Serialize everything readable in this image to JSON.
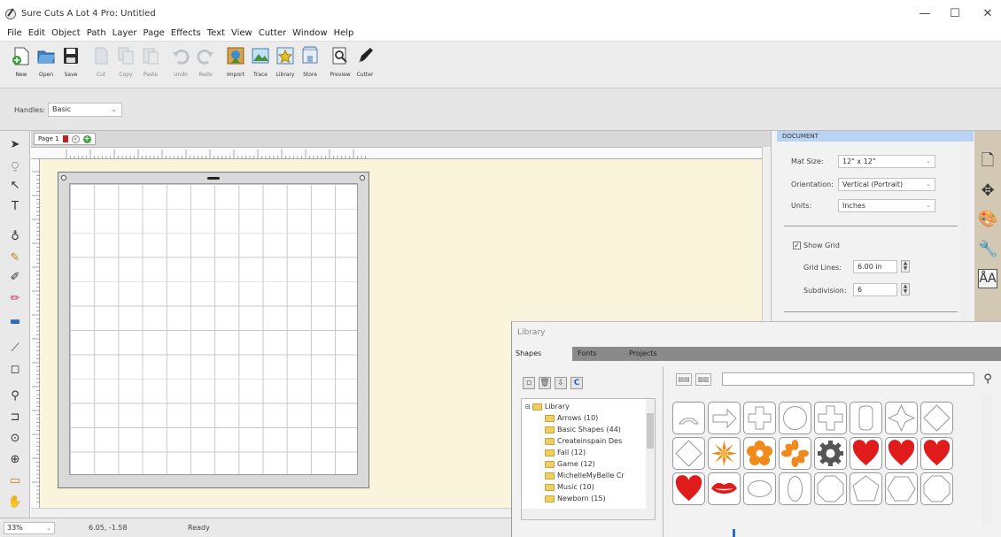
{
  "window": {
    "title": "Sure Cuts A Lot 4 Pro: Untitled",
    "minimize": "—",
    "maximize": "☐",
    "close": "✕"
  },
  "menu": [
    "File",
    "Edit",
    "Object",
    "Path",
    "Layer",
    "Page",
    "Effects",
    "Text",
    "View",
    "Cutter",
    "Window",
    "Help"
  ],
  "toolbar": {
    "new": "New",
    "open": "Open",
    "save": "Save",
    "cut": "Cut",
    "copy": "Copy",
    "paste": "Paste",
    "undo": "Undo",
    "redo": "Redo",
    "import": "Import",
    "trace": "Trace",
    "library": "Library",
    "store": "Store",
    "preview": "Preview",
    "cutter": "Cutter"
  },
  "handles": {
    "label": "Handles:",
    "value": "Basic"
  },
  "page_tab": {
    "label": "Page 1"
  },
  "document_panel": {
    "header": "DOCUMENT",
    "mat_size_label": "Mat Size:",
    "mat_size_value": "12\" x 12\"",
    "orientation_label": "Orientation:",
    "orientation_value": "Vertical (Portrait)",
    "units_label": "Units:",
    "units_value": "Inches",
    "show_grid_label": "Show Grid",
    "show_grid_checked": true,
    "grid_lines_label": "Grid Lines:",
    "grid_lines_value": "6.00 in",
    "subdivision_label": "Subdivision:",
    "subdivision_value": "6"
  },
  "library": {
    "title": "Library",
    "tabs": [
      "Shapes",
      "Fonts",
      "Projects"
    ],
    "tree": [
      {
        "label": "Library",
        "level": 0
      },
      {
        "label": "Arrows (10)",
        "level": 1
      },
      {
        "label": "Basic Shapes (44)",
        "level": 1
      },
      {
        "label": "Createinspain Des",
        "level": 1
      },
      {
        "label": "Fall (12)",
        "level": 1
      },
      {
        "label": "Game (12)",
        "level": 1
      },
      {
        "label": "MichelleMyBelle Cr",
        "level": 1
      },
      {
        "label": "Music (10)",
        "level": 1
      },
      {
        "label": "Newborn (15)",
        "level": 1
      }
    ]
  },
  "status": {
    "zoom": "33%",
    "coordinates": "6.05, -1.58",
    "state": "Ready"
  }
}
